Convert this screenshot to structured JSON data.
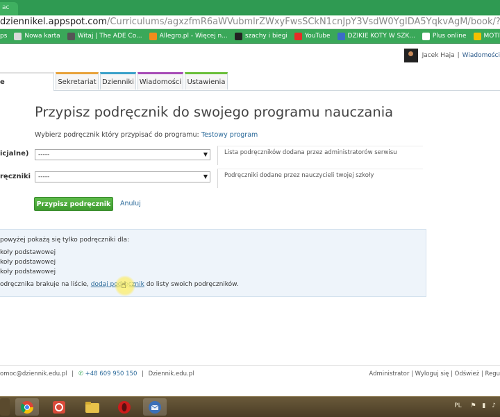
{
  "browser": {
    "tab_label": "ac",
    "url_host": "dziennikel.appspot.com",
    "url_path": "/Curriculums/agxzfmR6aWVubmlrZWxyFwsSCkN1cnJpY3VsdW0YgIDA5YqkvAgM/book/?next=https://dzienniki",
    "bookmarks": [
      {
        "label": "ps",
        "color": "#3aa859"
      },
      {
        "label": "Nowa karta",
        "color": "#d9d9d9"
      },
      {
        "label": "Witaj | The ADE Co...",
        "color": "#555555"
      },
      {
        "label": "Allegro.pl - Więcej n...",
        "color": "#f28c1c"
      },
      {
        "label": "szachy i biegi",
        "color": "#222222"
      },
      {
        "label": "YouTube",
        "color": "#e52d27"
      },
      {
        "label": "DZIKIE KOTY W SZK...",
        "color": "#3b6cc7"
      },
      {
        "label": "Plus online",
        "color": "#ffffff"
      },
      {
        "label": "MOTIVATO.pl",
        "color": "#f5c000"
      }
    ]
  },
  "user": {
    "name": "Jacek Haja",
    "separator": "|",
    "messages": "Wiadomości"
  },
  "nav": {
    "home": "e",
    "tabs": [
      {
        "label": "Sekretariat",
        "color": "#e8a23a"
      },
      {
        "label": "Dzienniki",
        "color": "#3aa1c9"
      },
      {
        "label": "Wiadomości",
        "color": "#a74bb6"
      },
      {
        "label": "Ustawienia",
        "color": "#6abf3a"
      }
    ]
  },
  "main": {
    "title": "Przypisz podręcznik do swojego programu nauczania",
    "subtitle_prefix": "Wybierz podręcznik który przypisać do programu:",
    "program_name": "Testowy program",
    "field1": {
      "label": "icjalne)",
      "value": "-----",
      "hint": "Lista podręczników dodana przez administratorów serwisu"
    },
    "field2": {
      "label": "ręczniki",
      "value": "-----",
      "hint": "Podręczniki dodane przez nauczycieli twojej szkoły"
    },
    "assign_button": "Przypisz podręcznik",
    "cancel_link": "Anuluj"
  },
  "info": {
    "line1": "powyżej pokażą się tylko podręczniki dla:",
    "items": [
      "koły podstawowej",
      "koły podstawowej",
      "koły podstawowej"
    ],
    "missing_prefix": "odręcznika brakuje na liście,",
    "add_link": "dodaj podręcznik",
    "missing_suffix": "do listy swoich podręczników."
  },
  "footer": {
    "email": "omoc@dziennik.edu.pl",
    "phone": "+48 609 950 150",
    "site": "Dziennik.edu.pl",
    "links": [
      "Administrator",
      "Wyloguj się",
      "Odśwież",
      "Regu"
    ]
  },
  "taskbar": {
    "lang": "PL"
  }
}
